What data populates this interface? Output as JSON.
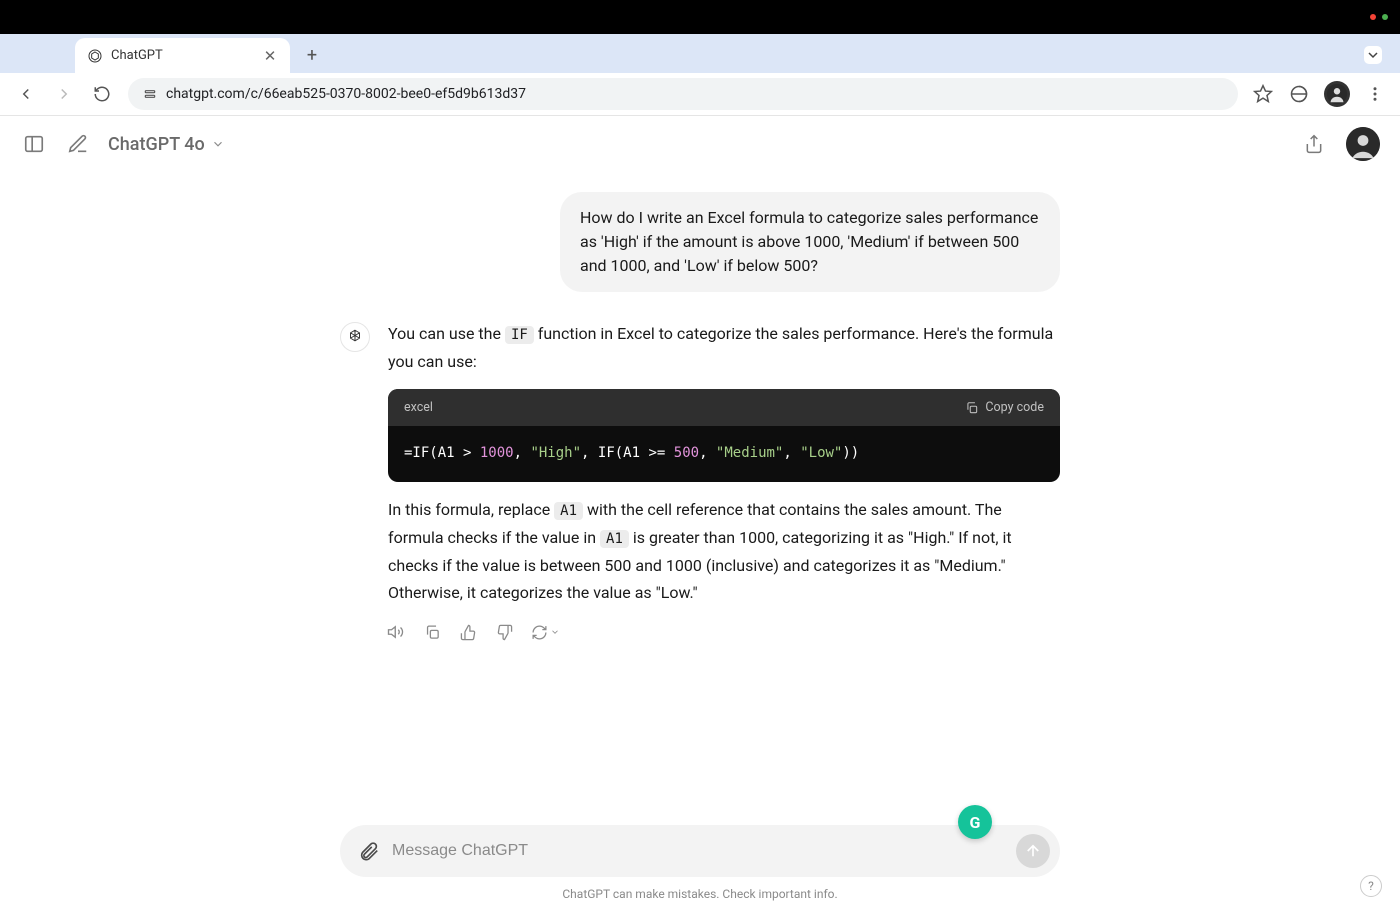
{
  "browser": {
    "tab_title": "ChatGPT",
    "url": "chatgpt.com/c/66eab525-0370-8002-bee0-ef5d9b613d37"
  },
  "header": {
    "model_label": "ChatGPT 4o"
  },
  "conversation": {
    "user_message": "How do I write an Excel formula to categorize sales performance as 'High' if the amount is above 1000, 'Medium' if between 500 and 1000, and 'Low' if below 500?",
    "assistant": {
      "para1_prefix": "You can use the ",
      "para1_code": "IF",
      "para1_suffix": " function in Excel to categorize the sales performance. Here's the formula you can use:",
      "code_lang": "excel",
      "copy_label": "Copy code",
      "code_content": "=IF(A1 > 1000, \"High\", IF(A1 >= 500, \"Medium\", \"Low\"))",
      "para2_a": "In this formula, replace ",
      "para2_code1": "A1",
      "para2_b": " with the cell reference that contains the sales amount. The formula checks if the value in ",
      "para2_code2": "A1",
      "para2_c": " is greater than 1000, categorizing it as \"High.\" If not, it checks if the value is between 500 and 1000 (inclusive) and categorizes it as \"Medium.\" Otherwise, it categorizes the value as \"Low.\""
    }
  },
  "input": {
    "placeholder": "Message ChatGPT"
  },
  "footer": {
    "disclaimer": "ChatGPT can make mistakes. Check important info."
  },
  "grammarly_letter": "G",
  "help_symbol": "?"
}
